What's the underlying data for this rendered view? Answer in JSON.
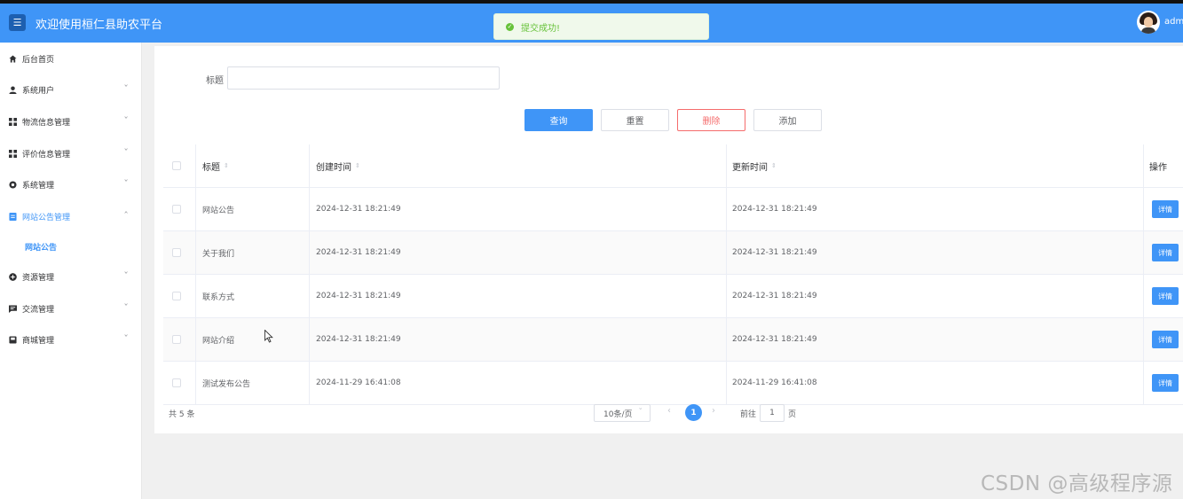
{
  "header": {
    "title": "欢迎使用桓仁县助农平台",
    "menu_icon": "hamburger-icon",
    "username": "admi"
  },
  "toast": {
    "message": "提交成功!",
    "color": "#67c23a"
  },
  "sidebar": {
    "items": [
      {
        "label": "后台首页",
        "icon": "home-icon"
      },
      {
        "label": "系统用户",
        "icon": "user-icon"
      },
      {
        "label": "物流信息管理",
        "icon": "grid-icon"
      },
      {
        "label": "评价信息管理",
        "icon": "grid-icon"
      },
      {
        "label": "系统管理",
        "icon": "gear-icon"
      },
      {
        "label": "网站公告管理",
        "icon": "document-icon"
      },
      {
        "label": "资源管理",
        "icon": "plus-circle-icon"
      },
      {
        "label": "交流管理",
        "icon": "chat-icon"
      },
      {
        "label": "商城管理",
        "icon": "shop-icon"
      }
    ],
    "active_sub_item": "网站公告"
  },
  "filter": {
    "label": "标题",
    "value": ""
  },
  "buttons": {
    "query": "查询",
    "reset": "重置",
    "delete": "删除",
    "add": "添加"
  },
  "table": {
    "headers": {
      "title": "标题",
      "created": "创建时间",
      "updated": "更新时间",
      "actions": "操作"
    },
    "rows": [
      {
        "title": "网站公告",
        "created": "2024-12-31 18:21:49",
        "updated": "2024-12-31 18:21:49",
        "action": "详情"
      },
      {
        "title": "关于我们",
        "created": "2024-12-31 18:21:49",
        "updated": "2024-12-31 18:21:49",
        "action": "详情"
      },
      {
        "title": "联系方式",
        "created": "2024-12-31 18:21:49",
        "updated": "2024-12-31 18:21:49",
        "action": "详情"
      },
      {
        "title": "网站介绍",
        "created": "2024-12-31 18:21:49",
        "updated": "2024-12-31 18:21:49",
        "action": "详情"
      },
      {
        "title": "测试发布公告",
        "created": "2024-11-29 16:41:08",
        "updated": "2024-11-29 16:41:08",
        "action": "详情"
      }
    ]
  },
  "pagination": {
    "total": "共 5 条",
    "page_size": "10条/页",
    "current_page": "1",
    "goto_label": "前往",
    "goto_value": "1",
    "page_unit": "页"
  },
  "watermark": "CSDN @高级程序源",
  "colors": {
    "primary": "#3f95f7",
    "danger": "#f56c6c",
    "success": "#67c23a"
  }
}
